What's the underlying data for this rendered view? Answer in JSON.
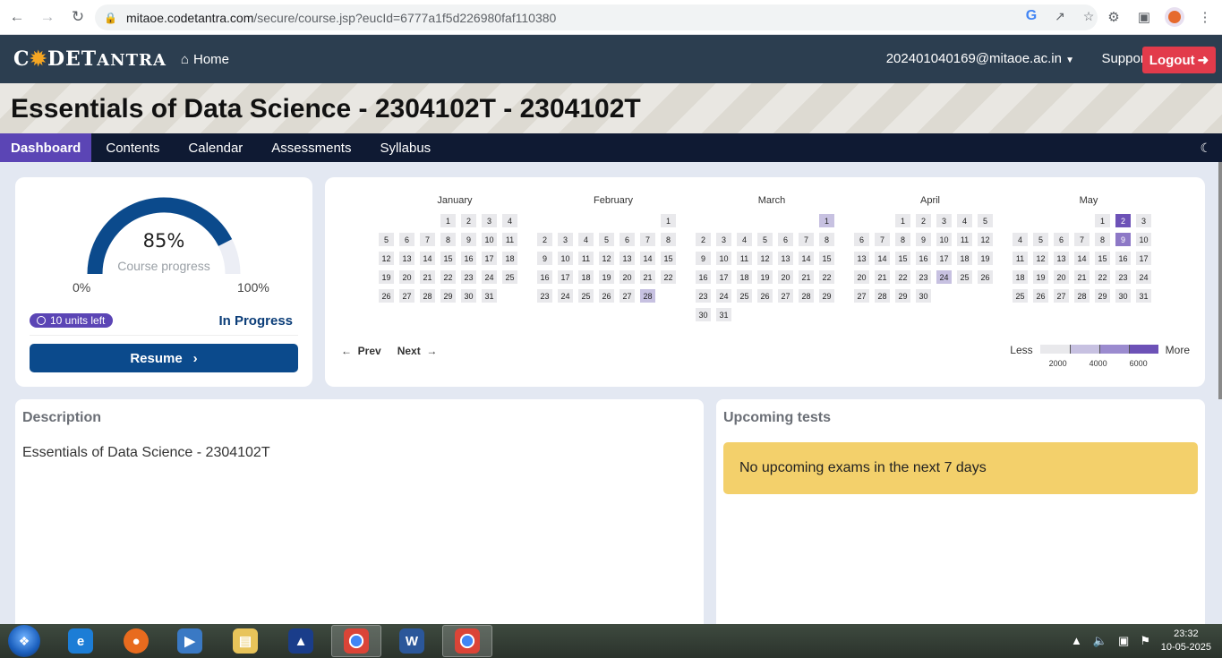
{
  "browser": {
    "url_host": "mitaoe.codetantra.com",
    "url_path": "/secure/course.jsp?eucId=6777a1f5d226980faf110380"
  },
  "header": {
    "logo": "CODETANTRA",
    "home_label": "Home",
    "user_email": "202401040169@mitaoe.ac.in",
    "support_label": "Support",
    "logout_label": "Logout"
  },
  "banner": {
    "title": "Essentials of Data Science - 2304102T - 2304102T"
  },
  "tabs": [
    {
      "label": "Dashboard",
      "active": true
    },
    {
      "label": "Contents"
    },
    {
      "label": "Calendar"
    },
    {
      "label": "Assessments"
    },
    {
      "label": "Syllabus"
    }
  ],
  "progress": {
    "value_text": "85%",
    "value": 0.85,
    "label": "Course progress",
    "min_label": "0%",
    "max_label": "100%",
    "units_left": "10 units left",
    "status": "In Progress",
    "resume_label": "Resume"
  },
  "calendar": {
    "months": [
      {
        "name": "January",
        "offset": 3,
        "days": 31,
        "highlights": {}
      },
      {
        "name": "February",
        "offset": 6,
        "days": 28,
        "highlights": {
          "28": 1
        }
      },
      {
        "name": "March",
        "offset": 6,
        "days": 31,
        "highlights": {
          "1": 1
        }
      },
      {
        "name": "April",
        "offset": 2,
        "days": 30,
        "highlights": {
          "24": 1
        }
      },
      {
        "name": "May",
        "offset": 4,
        "days": 31,
        "highlights": {
          "2": 3,
          "9": 2
        }
      }
    ],
    "prev_label": "Prev",
    "next_label": "Next",
    "legend_less": "Less",
    "legend_more": "More",
    "legend_ticks": [
      "2000",
      "4000",
      "6000"
    ],
    "legend_colors": [
      "#e9e9ec",
      "#c7c1e1",
      "#9b8bcf",
      "#6d52b7"
    ]
  },
  "description": {
    "title": "Description",
    "text": "Essentials of Data Science - 2304102T"
  },
  "upcoming": {
    "title": "Upcoming tests",
    "notice": "No upcoming exams in the next 7 days"
  },
  "taskbar": {
    "time": "23:32",
    "date": "10-05-2025"
  }
}
